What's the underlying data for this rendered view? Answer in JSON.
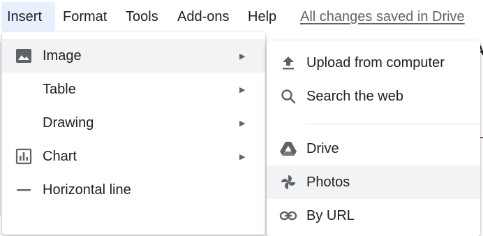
{
  "menubar": {
    "items": [
      {
        "label": "Insert"
      },
      {
        "label": "Format"
      },
      {
        "label": "Tools"
      },
      {
        "label": "Add-ons"
      },
      {
        "label": "Help"
      }
    ],
    "save_status": "All changes saved in Drive"
  },
  "insert_menu": {
    "items": [
      {
        "label": "Image",
        "icon": "image-icon",
        "has_submenu": true
      },
      {
        "label": "Table",
        "has_submenu": true
      },
      {
        "label": "Drawing",
        "has_submenu": true
      },
      {
        "label": "Chart",
        "icon": "chart-icon",
        "has_submenu": true
      },
      {
        "label": "Horizontal line",
        "icon": "horizontal-line-icon"
      }
    ],
    "submenu_arrow": "▶"
  },
  "image_submenu": {
    "items": [
      {
        "label": "Upload from computer",
        "icon": "upload-icon"
      },
      {
        "label": "Search the web",
        "icon": "search-icon"
      },
      {
        "label": "Drive",
        "icon": "drive-icon"
      },
      {
        "label": "Photos",
        "icon": "photos-icon"
      },
      {
        "label": "By URL",
        "icon": "link-icon"
      }
    ]
  },
  "colors": {
    "active_menu_bg": "#e8f0fe",
    "hover_row_bg": "#f1f3f4",
    "text": "#202124",
    "muted": "#5f6368"
  }
}
